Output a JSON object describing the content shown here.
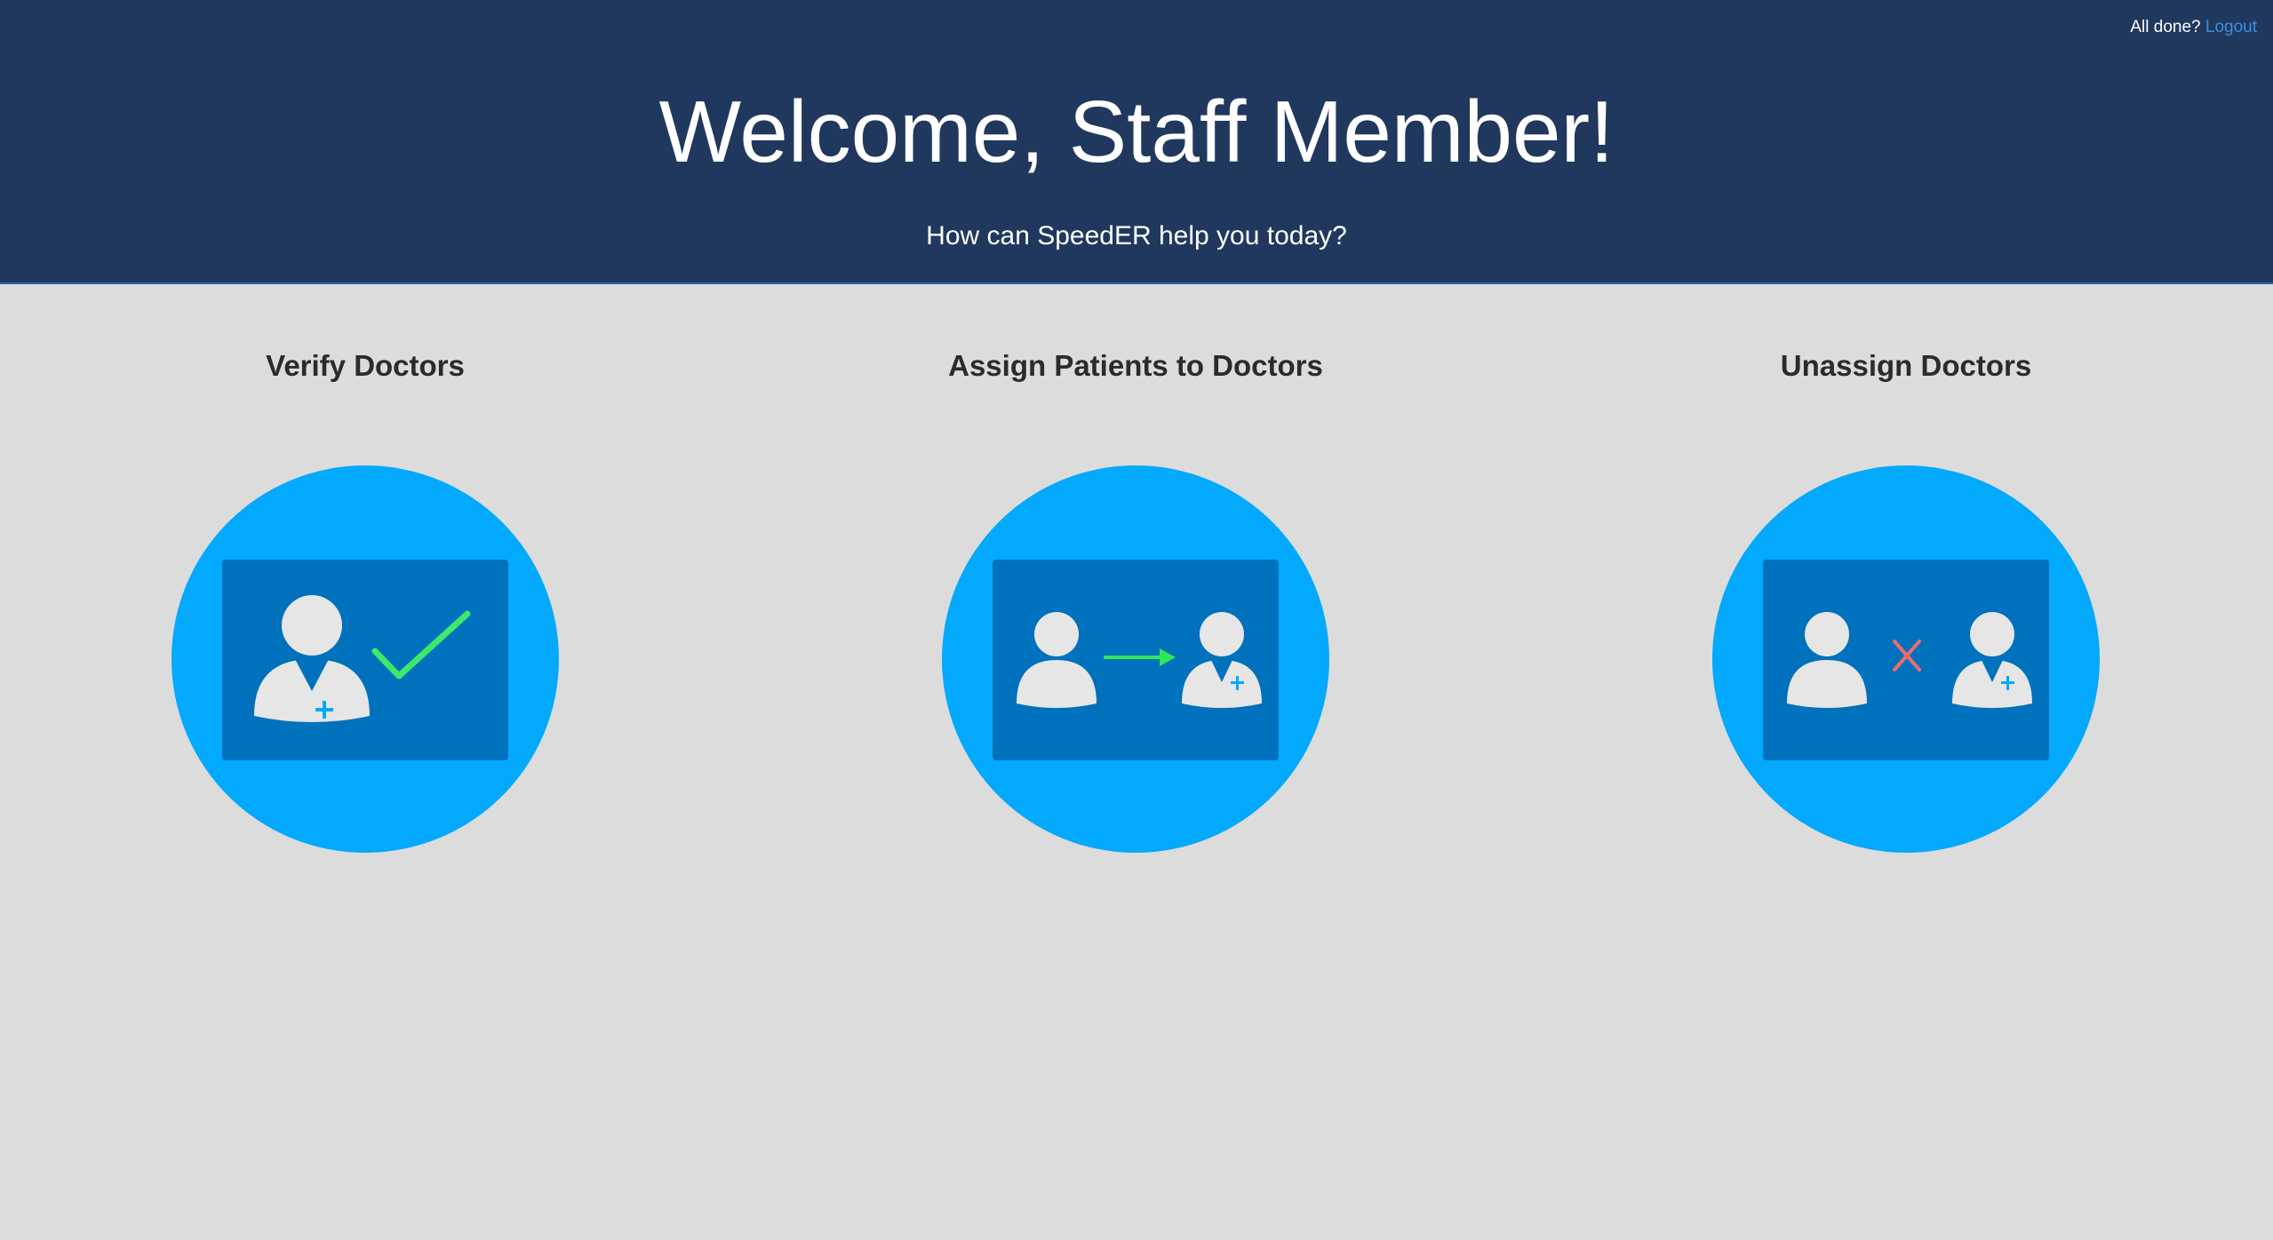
{
  "header": {
    "account_prompt": "All done?",
    "logout_label": "Logout",
    "title": "Welcome, Staff Member!",
    "subtitle": "How can SpeedER help you today?"
  },
  "actions": [
    {
      "label": "Verify Doctors",
      "icon": "verify-doctor-icon"
    },
    {
      "label": "Assign Patients to Doctors",
      "icon": "assign-patient-icon"
    },
    {
      "label": "Unassign Doctors",
      "icon": "unassign-doctor-icon"
    }
  ],
  "colors": {
    "header_bg": "#21385e",
    "page_bg": "#dcdcdc",
    "circle": "#03a9fc",
    "panel": "#0071bc",
    "person": "#e6e6e6",
    "check": "#3fe86a",
    "arrow": "#2ee65a",
    "cross": "#ee6b6b",
    "link": "#3b8ee0"
  }
}
